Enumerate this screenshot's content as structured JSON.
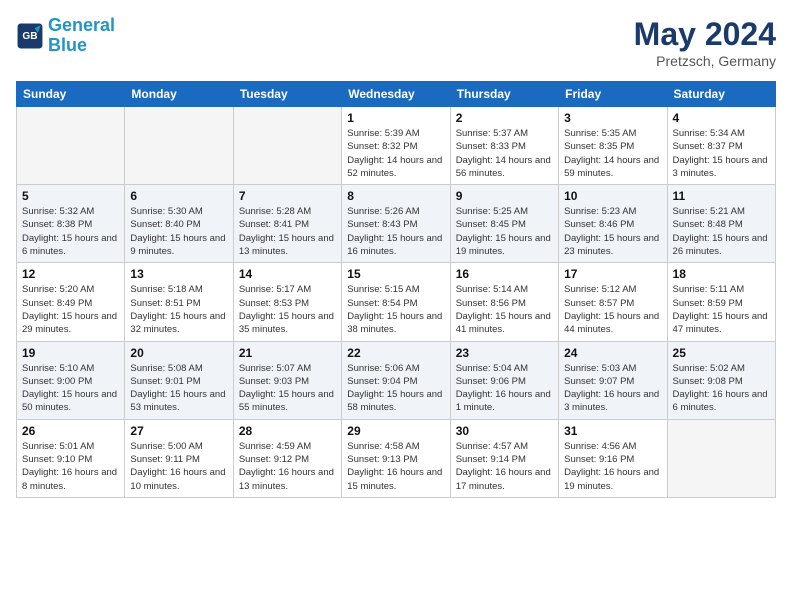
{
  "logo": {
    "general": "General",
    "blue": "Blue"
  },
  "title": "May 2024",
  "subtitle": "Pretzsch, Germany",
  "days_of_week": [
    "Sunday",
    "Monday",
    "Tuesday",
    "Wednesday",
    "Thursday",
    "Friday",
    "Saturday"
  ],
  "weeks": [
    [
      {
        "day": "",
        "info": ""
      },
      {
        "day": "",
        "info": ""
      },
      {
        "day": "",
        "info": ""
      },
      {
        "day": "1",
        "info": "Sunrise: 5:39 AM\nSunset: 8:32 PM\nDaylight: 14 hours and 52 minutes."
      },
      {
        "day": "2",
        "info": "Sunrise: 5:37 AM\nSunset: 8:33 PM\nDaylight: 14 hours and 56 minutes."
      },
      {
        "day": "3",
        "info": "Sunrise: 5:35 AM\nSunset: 8:35 PM\nDaylight: 14 hours and 59 minutes."
      },
      {
        "day": "4",
        "info": "Sunrise: 5:34 AM\nSunset: 8:37 PM\nDaylight: 15 hours and 3 minutes."
      }
    ],
    [
      {
        "day": "5",
        "info": "Sunrise: 5:32 AM\nSunset: 8:38 PM\nDaylight: 15 hours and 6 minutes."
      },
      {
        "day": "6",
        "info": "Sunrise: 5:30 AM\nSunset: 8:40 PM\nDaylight: 15 hours and 9 minutes."
      },
      {
        "day": "7",
        "info": "Sunrise: 5:28 AM\nSunset: 8:41 PM\nDaylight: 15 hours and 13 minutes."
      },
      {
        "day": "8",
        "info": "Sunrise: 5:26 AM\nSunset: 8:43 PM\nDaylight: 15 hours and 16 minutes."
      },
      {
        "day": "9",
        "info": "Sunrise: 5:25 AM\nSunset: 8:45 PM\nDaylight: 15 hours and 19 minutes."
      },
      {
        "day": "10",
        "info": "Sunrise: 5:23 AM\nSunset: 8:46 PM\nDaylight: 15 hours and 23 minutes."
      },
      {
        "day": "11",
        "info": "Sunrise: 5:21 AM\nSunset: 8:48 PM\nDaylight: 15 hours and 26 minutes."
      }
    ],
    [
      {
        "day": "12",
        "info": "Sunrise: 5:20 AM\nSunset: 8:49 PM\nDaylight: 15 hours and 29 minutes."
      },
      {
        "day": "13",
        "info": "Sunrise: 5:18 AM\nSunset: 8:51 PM\nDaylight: 15 hours and 32 minutes."
      },
      {
        "day": "14",
        "info": "Sunrise: 5:17 AM\nSunset: 8:53 PM\nDaylight: 15 hours and 35 minutes."
      },
      {
        "day": "15",
        "info": "Sunrise: 5:15 AM\nSunset: 8:54 PM\nDaylight: 15 hours and 38 minutes."
      },
      {
        "day": "16",
        "info": "Sunrise: 5:14 AM\nSunset: 8:56 PM\nDaylight: 15 hours and 41 minutes."
      },
      {
        "day": "17",
        "info": "Sunrise: 5:12 AM\nSunset: 8:57 PM\nDaylight: 15 hours and 44 minutes."
      },
      {
        "day": "18",
        "info": "Sunrise: 5:11 AM\nSunset: 8:59 PM\nDaylight: 15 hours and 47 minutes."
      }
    ],
    [
      {
        "day": "19",
        "info": "Sunrise: 5:10 AM\nSunset: 9:00 PM\nDaylight: 15 hours and 50 minutes."
      },
      {
        "day": "20",
        "info": "Sunrise: 5:08 AM\nSunset: 9:01 PM\nDaylight: 15 hours and 53 minutes."
      },
      {
        "day": "21",
        "info": "Sunrise: 5:07 AM\nSunset: 9:03 PM\nDaylight: 15 hours and 55 minutes."
      },
      {
        "day": "22",
        "info": "Sunrise: 5:06 AM\nSunset: 9:04 PM\nDaylight: 15 hours and 58 minutes."
      },
      {
        "day": "23",
        "info": "Sunrise: 5:04 AM\nSunset: 9:06 PM\nDaylight: 16 hours and 1 minute."
      },
      {
        "day": "24",
        "info": "Sunrise: 5:03 AM\nSunset: 9:07 PM\nDaylight: 16 hours and 3 minutes."
      },
      {
        "day": "25",
        "info": "Sunrise: 5:02 AM\nSunset: 9:08 PM\nDaylight: 16 hours and 6 minutes."
      }
    ],
    [
      {
        "day": "26",
        "info": "Sunrise: 5:01 AM\nSunset: 9:10 PM\nDaylight: 16 hours and 8 minutes."
      },
      {
        "day": "27",
        "info": "Sunrise: 5:00 AM\nSunset: 9:11 PM\nDaylight: 16 hours and 10 minutes."
      },
      {
        "day": "28",
        "info": "Sunrise: 4:59 AM\nSunset: 9:12 PM\nDaylight: 16 hours and 13 minutes."
      },
      {
        "day": "29",
        "info": "Sunrise: 4:58 AM\nSunset: 9:13 PM\nDaylight: 16 hours and 15 minutes."
      },
      {
        "day": "30",
        "info": "Sunrise: 4:57 AM\nSunset: 9:14 PM\nDaylight: 16 hours and 17 minutes."
      },
      {
        "day": "31",
        "info": "Sunrise: 4:56 AM\nSunset: 9:16 PM\nDaylight: 16 hours and 19 minutes."
      },
      {
        "day": "",
        "info": ""
      }
    ]
  ]
}
